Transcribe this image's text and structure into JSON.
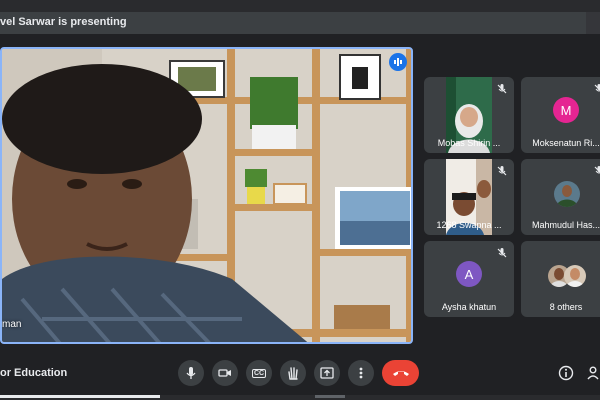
{
  "banner": {
    "presenting_text": "vel Sarwar is presenting"
  },
  "main_tile": {
    "participant_name": "man"
  },
  "participants": [
    {
      "name": "Mobas Shirin ...",
      "avatar": "photo",
      "muted": true
    },
    {
      "name": "Moksenatun Ri...",
      "avatar": "letter",
      "letter": "M",
      "color": "#e52592",
      "muted": true
    },
    {
      "name": "1268 Swapna ...",
      "avatar": "photo",
      "muted": true
    },
    {
      "name": "Mahmudul Has...",
      "avatar": "photo",
      "muted": true
    },
    {
      "name": "Aysha khatun",
      "avatar": "letter",
      "letter": "A",
      "color": "#7e57c2",
      "muted": true
    },
    {
      "name": "8 others",
      "avatar": "group",
      "muted": false
    }
  ],
  "bottom_bar": {
    "meeting_title": "or Education",
    "controls": [
      "microphone-icon",
      "camera-icon",
      "captions-icon",
      "raise-hand-icon",
      "present-icon",
      "more-options-icon"
    ],
    "captions_label": "CC"
  },
  "colors": {
    "accent": "#8ab4f8",
    "end_call": "#ea4335",
    "speaking": "#1a73e8"
  }
}
